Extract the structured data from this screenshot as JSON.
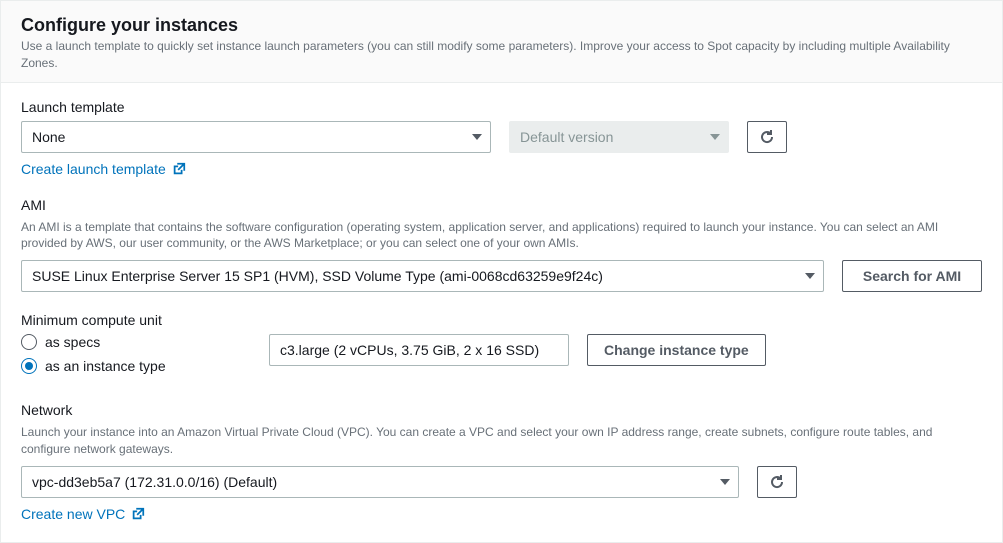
{
  "header": {
    "title": "Configure your instances",
    "description": "Use a launch template to quickly set instance launch parameters (you can still modify some parameters). Improve your access to Spot capacity by including multiple Availability Zones."
  },
  "launch_template": {
    "label": "Launch template",
    "selected": "None",
    "version_placeholder": "Default version",
    "create_link": "Create launch template"
  },
  "ami": {
    "label": "AMI",
    "description": "An AMI is a template that contains the software configuration (operating system, application server, and applications) required to launch your instance. You can select an AMI provided by AWS, our user community, or the AWS Marketplace; or you can select one of your own AMIs.",
    "selected": "SUSE Linux Enterprise Server 15 SP1 (HVM), SSD Volume Type (ami-0068cd63259e9f24c)",
    "search_button": "Search for AMI"
  },
  "compute": {
    "label": "Minimum compute unit",
    "option_specs": "as specs",
    "option_instance": "as an instance type",
    "selected": "instance",
    "instance_detail": "c3.large (2 vCPUs, 3.75 GiB, 2 x 16 SSD)",
    "change_button": "Change instance type"
  },
  "network": {
    "label": "Network",
    "description": "Launch your instance into an Amazon Virtual Private Cloud (VPC). You can create a VPC and select your own IP address range, create subnets, configure route tables, and configure network gateways.",
    "selected": "vpc-dd3eb5a7 (172.31.0.0/16) (Default)",
    "create_link": "Create new VPC"
  }
}
